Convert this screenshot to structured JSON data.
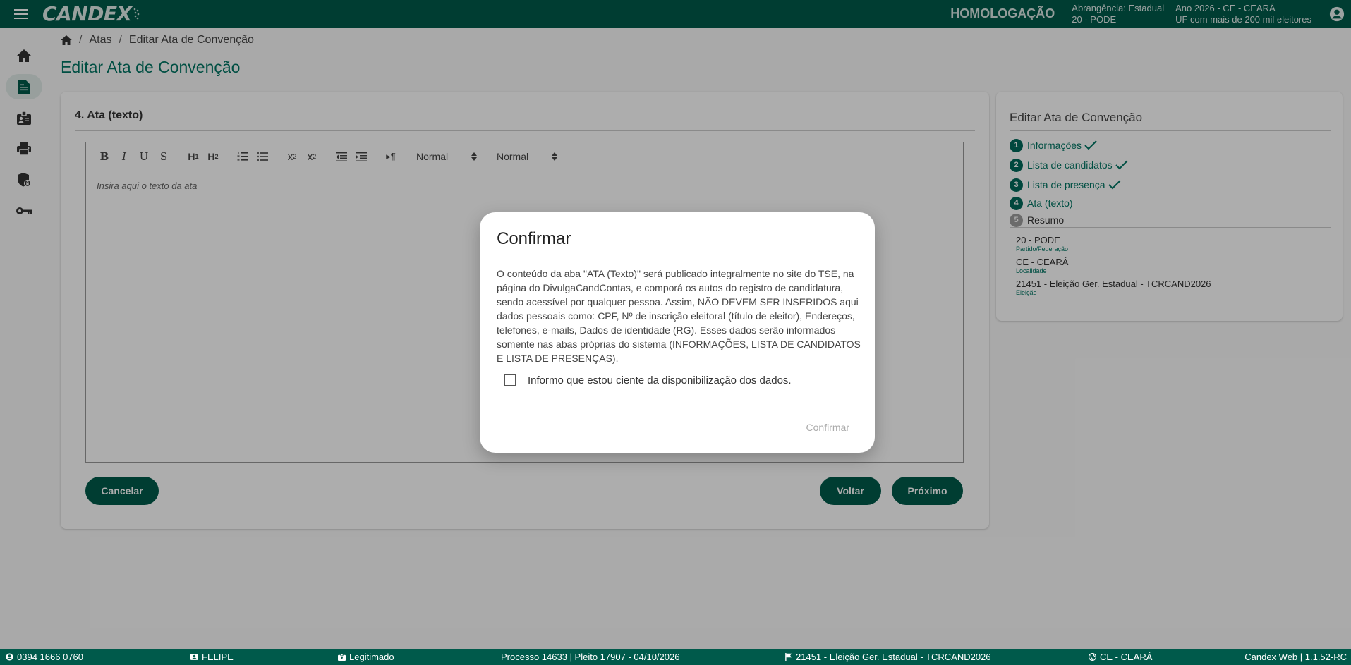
{
  "header": {
    "logo_text": "CANDEX",
    "environment": "HOMOLOGAÇÃO",
    "scope_line1": "Abrangência: Estadual",
    "scope_line2": "20 - PODE",
    "year_line1": "Ano 2026 - CE - CEARÁ",
    "year_line2": "UF com mais de 200 mil eleitores"
  },
  "rail": [
    {
      "icon": "home-icon"
    },
    {
      "icon": "document-icon",
      "active": true
    },
    {
      "icon": "id-badge-icon"
    },
    {
      "icon": "printer-icon"
    },
    {
      "icon": "shield-lock-icon"
    },
    {
      "icon": "key-icon"
    }
  ],
  "breadcrumb": {
    "items": [
      "Atas",
      "Editar Ata de Convenção"
    ]
  },
  "page": {
    "title": "Editar Ata de Convenção",
    "section_title": "4. Ata (texto)"
  },
  "editor": {
    "select_1": "Normal",
    "select_2": "Normal",
    "placeholder": "Insira aqui o texto da ata"
  },
  "buttons": {
    "cancel": "Cancelar",
    "back": "Voltar",
    "next": "Próximo"
  },
  "side": {
    "title": "Editar Ata de Convenção",
    "steps": [
      {
        "num": "1",
        "label": "Informações",
        "done": true
      },
      {
        "num": "2",
        "label": "Lista de candidatos",
        "done": true
      },
      {
        "num": "3",
        "label": "Lista de presença",
        "done": true
      },
      {
        "num": "4",
        "label": "Ata (texto)",
        "done": false
      },
      {
        "num": "5",
        "label": "Resumo",
        "done": false
      }
    ],
    "info": [
      {
        "value": "20 - PODE",
        "label": "Partido/Federação"
      },
      {
        "value": "CE - CEARÁ",
        "label": "Localidade"
      },
      {
        "value": "21451 - Eleição Ger. Estadual - TCRCAND2026",
        "label": "Eleição"
      }
    ]
  },
  "modal": {
    "title": "Confirmar",
    "body": "O conteúdo da aba \"ATA (Texto)\" será publicado integralmente no site do TSE, na página do DivulgaCandContas, e comporá os autos do registro de candidatura, sendo acessível por qualquer pessoa. Assim, NÃO DEVEM SER INSERIDOS aqui dados pessoais como: CPF, Nº de inscrição eleitoral (título de eleitor), Endereços, telefones, e-mails, Dados de identidade (RG). Esses dados serão informados somente nas abas próprias do sistema (INFORMAÇÕES, LISTA DE CANDIDATOS E LISTA DE PRESENÇAS).",
    "checkbox_label": "Informo que estou ciente da disponibilização dos dados.",
    "confirm_label": "Confirmar"
  },
  "footer": {
    "phone": "0394 1666 0760",
    "user": "FELIPE",
    "status": "Legitimado",
    "process": "Processo 14633 | Pleito 17907 - 04/10/2026",
    "election": "21451 - Eleição Ger. Estadual - TCRCAND2026",
    "locality": "CE - CEARÁ",
    "version": "Candex Web | 1.1.52-RC"
  }
}
